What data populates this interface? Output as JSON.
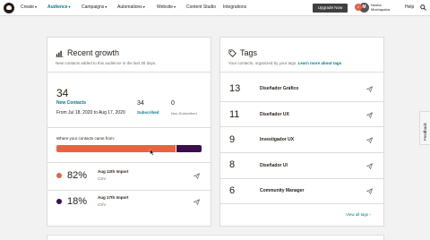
{
  "nav": {
    "items": [
      "Create",
      "Audience",
      "Campaigns",
      "Automations",
      "Website",
      "Content Studio",
      "Integrations"
    ],
    "upgrade_label": "Upgrade Now",
    "notification_count": "2",
    "avatar_initial": "M",
    "user_name_line1": "Nusha",
    "user_name_line2": "Muchapatra",
    "help_label": "Help"
  },
  "growth": {
    "title": "Recent growth",
    "subtitle": "New contacts added to this audience in the last 30 days.",
    "new_contacts_count": "34",
    "new_contacts_label": "New Contacts",
    "date_range": "From Jul 18, 2020 to Aug 17, 2020",
    "subscribed_count": "34",
    "subscribed_label": "Subscribed",
    "unsubscribed_count": "0",
    "unsubscribed_label": "Non-Subscribed",
    "sources_label": "Where your contacts came from:",
    "sources": [
      {
        "percent": "82%",
        "name": "Aug 12th Import",
        "type": "CSV",
        "color": "#e7643f",
        "share": 0.82
      },
      {
        "percent": "18%",
        "name": "Aug 17th Import",
        "type": "CSV",
        "color": "#3b0e4e",
        "share": 0.18
      }
    ]
  },
  "tags": {
    "title": "Tags",
    "subtitle": "Your contacts, organized by your tags.",
    "learn_more": "Learn more about tags",
    "items": [
      {
        "count": "13",
        "name": "Diseñador Gráfico"
      },
      {
        "count": "11",
        "name": "Diseñador UX"
      },
      {
        "count": "9",
        "name": "Investigador UX"
      },
      {
        "count": "8",
        "name": "Diseñador UI"
      },
      {
        "count": "6",
        "name": "Community Manager"
      }
    ],
    "view_all": "View all tags ›"
  },
  "feedback_label": "Feedback"
}
